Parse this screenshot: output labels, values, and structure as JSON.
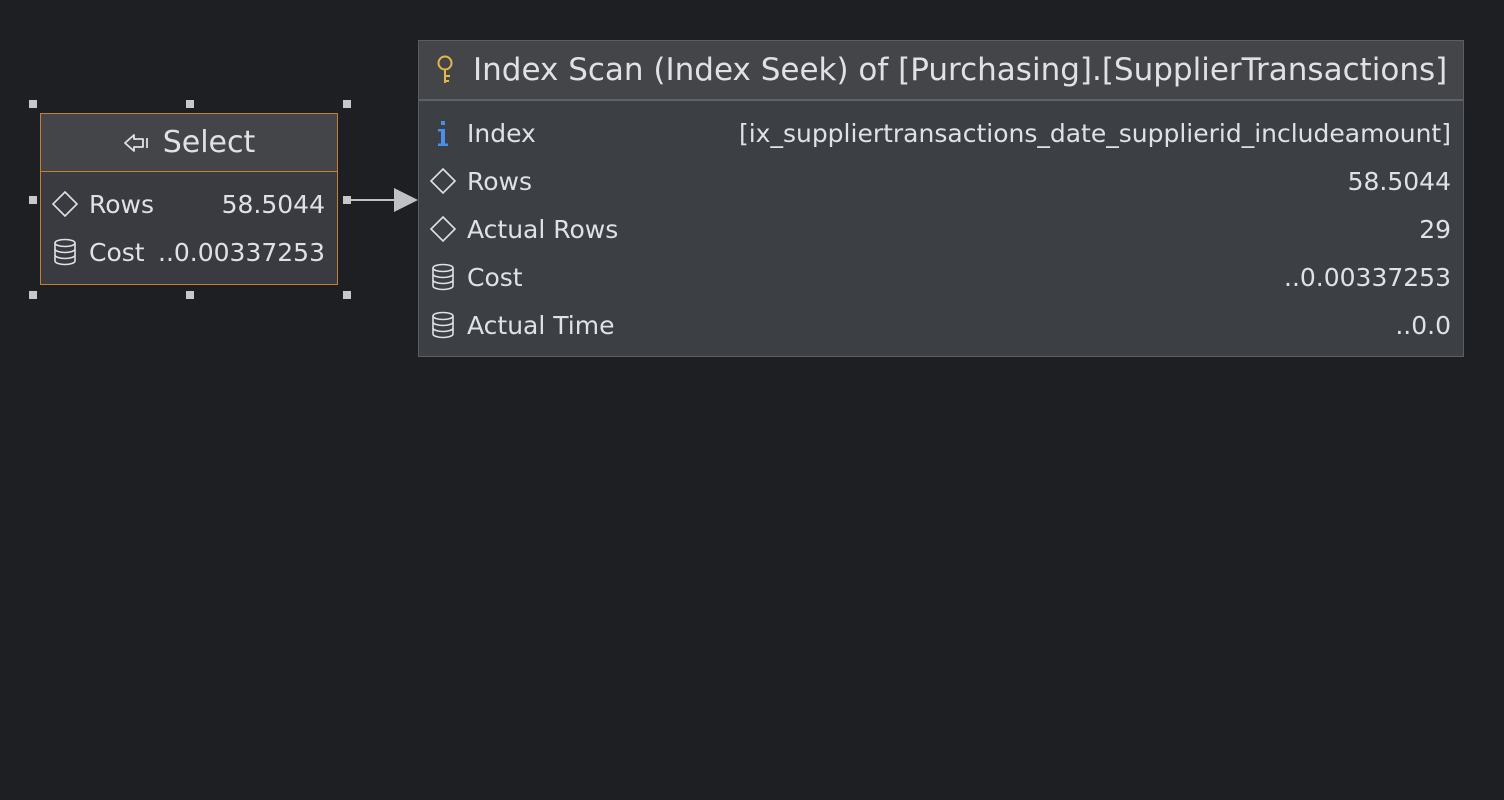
{
  "select_node": {
    "title": "Select",
    "title_icon": "arrow-left-from-line-icon",
    "rows": [
      {
        "icon": "diamond-icon",
        "label": "Rows",
        "value": "58.5044"
      },
      {
        "icon": "database-icon",
        "label": "Cost",
        "value": "..0.00337253"
      }
    ]
  },
  "scan_node": {
    "title": "Index Scan (Index Seek) of [Purchasing].[SupplierTransactions]",
    "title_icon": "key-icon",
    "rows": [
      {
        "icon": "info-icon",
        "label": "Index",
        "value": "[ix_suppliertransactions_date_supplierid_includeamount]"
      },
      {
        "icon": "diamond-icon",
        "label": "Rows",
        "value": "58.5044"
      },
      {
        "icon": "diamond-icon",
        "label": "Actual Rows",
        "value": "29"
      },
      {
        "icon": "database-icon",
        "label": "Cost",
        "value": "..0.00337253"
      },
      {
        "icon": "database-icon",
        "label": "Actual Time",
        "value": "..0.0"
      }
    ]
  },
  "colors": {
    "background": "#1e1f22",
    "node_body": "#393b40",
    "node_header": "#434548",
    "selection_border": "#c77d34",
    "key_icon": "#e8b548",
    "info_icon": "#4a8fe8",
    "connector": "#bfc1c5"
  }
}
